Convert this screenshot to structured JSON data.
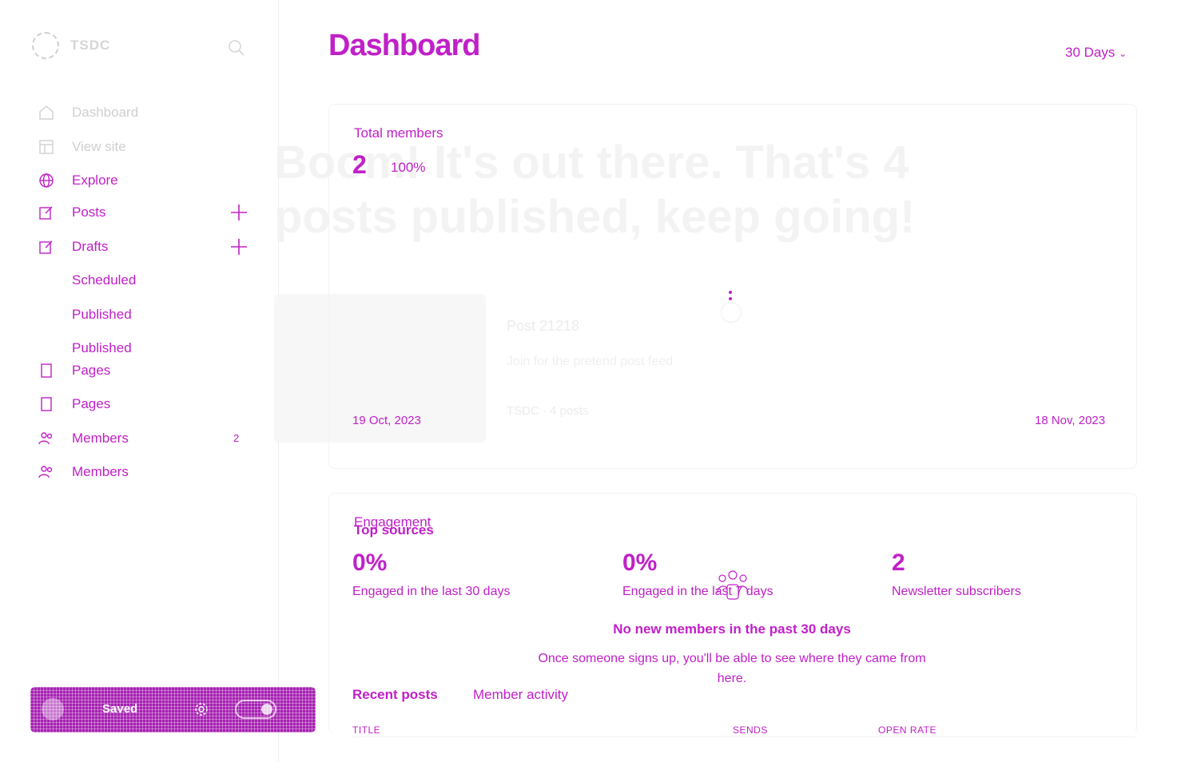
{
  "sidebar": {
    "brand": "TSDC",
    "items": [
      {
        "label": "Dashboard",
        "icon": "home-icon"
      },
      {
        "label": "View site",
        "icon": "layout-icon"
      },
      {
        "label": "Explore",
        "icon": "globe-icon"
      },
      {
        "label": "Posts",
        "icon": "edit-icon"
      },
      {
        "label": "Drafts",
        "icon": "edit-icon"
      },
      {
        "label": "Scheduled"
      },
      {
        "label": "Published"
      },
      {
        "label": "Published"
      },
      {
        "label": "Pages",
        "icon": "page-icon"
      },
      {
        "label": "Pages",
        "icon": "page-icon"
      },
      {
        "label": "Members",
        "icon": "members-icon",
        "badge": "2"
      },
      {
        "label": "Members",
        "icon": "members-icon"
      }
    ]
  },
  "saved_bar": {
    "label": "Saved"
  },
  "header": {
    "title": "Dashboard",
    "range": "30 Days"
  },
  "background_hero": "Boom! It's out there. That's 4 posts published, keep going!",
  "post_preview": {
    "title": "Post 21218",
    "excerpt": "Join for the pretend post feed",
    "meta": "TSDC · 4 posts"
  },
  "members_card": {
    "label": "Total members",
    "value": "2",
    "delta": "100%",
    "start_date": "19 Oct, 2023",
    "end_date": "18 Nov, 2023"
  },
  "engagement": {
    "label": "Engagement",
    "metrics": [
      {
        "value": "0%",
        "label": "Engaged in the last 30 days"
      },
      {
        "value": "0%",
        "label": "Engaged in the last 7 days"
      },
      {
        "value": "2",
        "label": "Newsletter subscribers"
      }
    ]
  },
  "empty_state": {
    "overlay_label": "Top sources",
    "title": "No new members in the past 30 days",
    "description": "Once someone signs up, you'll be able to see where they came from here."
  },
  "tabs": [
    "Recent posts",
    "Member activity"
  ],
  "table": {
    "columns": [
      "TITLE",
      "SENDS",
      "OPEN RATE"
    ]
  }
}
